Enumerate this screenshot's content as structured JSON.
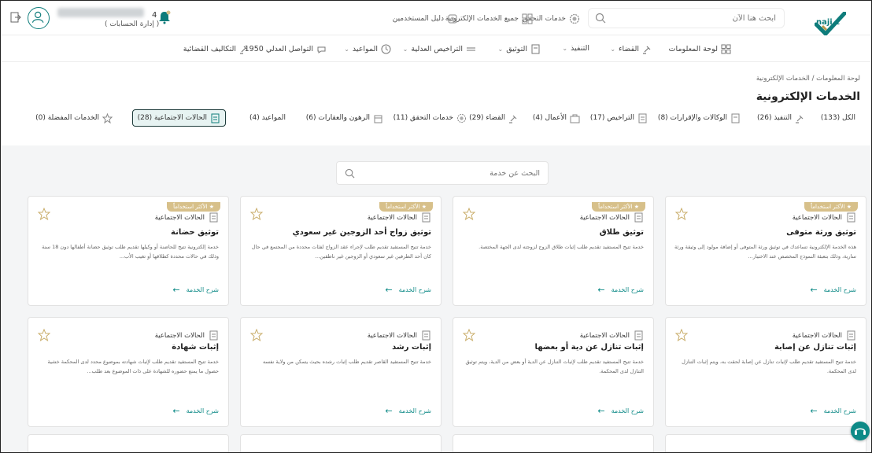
{
  "header": {
    "logo_text": "naji z",
    "search_placeholder": "ابحث هنا الآن",
    "links": [
      {
        "label": "خدمات التحقق"
      },
      {
        "label": "جميع الخدمات الإلكترونية"
      },
      {
        "label": "دليل المستخدمين"
      }
    ],
    "account_manage": "( إدارة الحسابات )",
    "notifications_count": "4"
  },
  "nav": {
    "items": [
      {
        "label": "لوحة المعلومات"
      },
      {
        "label": "القضاء"
      },
      {
        "label": "التنفيذ"
      },
      {
        "label": "التوثيق"
      },
      {
        "label": "التراخيص العدلية"
      },
      {
        "label": "المواعيد"
      },
      {
        "label": "التواصل العدلي 1950"
      },
      {
        "label": "التكاليف القضائية"
      }
    ]
  },
  "page": {
    "breadcrumb": "لوحة المعلومات  /  الخدمات الإلكترونية",
    "title": "الخدمات الإلكترونية",
    "tabs": [
      {
        "label": "الكل (133)"
      },
      {
        "label": "التنفيذ (26)"
      },
      {
        "label": "الوكالات والإقرارات (8)"
      },
      {
        "label": "التراخيص (17)"
      },
      {
        "label": "الأعمال (4)"
      },
      {
        "label": "القضاء (29)"
      },
      {
        "label": "خدمات التحقق (11)"
      },
      {
        "label": "الرهون والعقارات (6)"
      },
      {
        "label": "المواعيد (4)"
      },
      {
        "label": "الحالات الاجتماعية (28)"
      },
      {
        "label": "الخدمات المفضلة (0)"
      }
    ],
    "search_placeholder": "البحث عن خدمة"
  },
  "cards": [
    {
      "badge": "★ الأكثر استخداماً",
      "category": "الحالات الاجتماعية",
      "title": "توثيق ورثة متوفى",
      "desc": "هذه الخدمة الإلكترونية تساعدك في توثيق ورثة المتوفى أو إضافة مولود إلى وثيقة ورثة سارية، وذلك بتعبئة النموذج المخصص عند الاختيار...",
      "more": "شرح الخدمة"
    },
    {
      "badge": "★ الأكثر استخداماً",
      "category": "الحالات الاجتماعية",
      "title": "توثيق طلاق",
      "desc": "خدمة تتيح المستفيد تقديم طلب إثبات طلاق الزوج لزوجته لدى الجهة المختصة.",
      "more": "شرح الخدمة"
    },
    {
      "badge": "★ الأكثر استخداماً",
      "category": "الحالات الاجتماعية",
      "title": "توثيق زواج أحد الزوجين غير سعودي",
      "desc": "خدمة تتيح المستفيد تقديم طلب لإجراء عقد الزواج لفئات محددة من المجتمع في حال كان أحد الطرفين غير سعودي أو الزوجين غير ناطقين...",
      "more": "شرح الخدمة"
    },
    {
      "badge": "★ الأكثر استخداماً",
      "category": "الحالات الاجتماعية",
      "title": "توثيق حضانة",
      "desc": "خدمة إلكترونية تتيح للحاضنة أو وكيلها تقديم طلب توثيق حضانة أطفالها دون 18 سنة وذلك في حالات محددة كطلاقها أو تغيب الأب...",
      "more": "شرح الخدمة"
    },
    {
      "category": "الحالات الاجتماعية",
      "title": "إثبات تنازل عن إصابة",
      "desc": "خدمة تتيح المستفيد تقديم طلب لإثبات تنازل عن إصابة لحقت به، ويتم إثبات التنازل لدى المحكمة.",
      "more": "شرح الخدمة"
    },
    {
      "category": "الحالات الاجتماعية",
      "title": "إثبات تنازل عن دية أو بعضها",
      "desc": "خدمة تتيح المستفيد تقديم طلب لإثبات التنازل عن الدية أو بعض من الدية، ويتم توثيق التنازل لدى المحكمة.",
      "more": "شرح الخدمة"
    },
    {
      "category": "الحالات الاجتماعية",
      "title": "إثبات رشد",
      "desc": "خدمة تتيح المستفيد القاصر تقديم طلب إثبات رشده بحيث يتمكن من ولاية نفسه",
      "more": "شرح الخدمة"
    },
    {
      "category": "الحالات الاجتماعية",
      "title": "إثبات شهادة",
      "desc": "خدمة تتيح المستفيد تقديم طلب لإثبات شهادته بموضوع محدد لدى المحكمة خشية حصول ما يمنع حضوره للشهادة على ذات الموضوع بعد طلب...",
      "more": "شرح الخدمة"
    }
  ],
  "colors": {
    "brand": "#0e8a87",
    "accent_gold": "#d7c08a"
  }
}
